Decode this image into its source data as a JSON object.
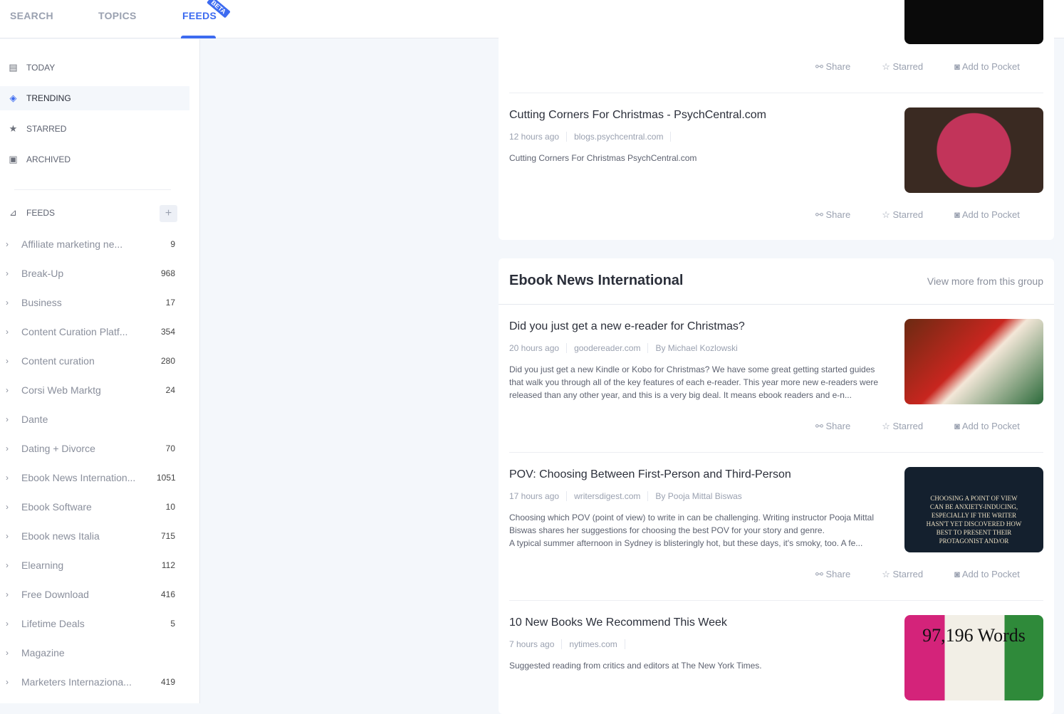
{
  "tabs": [
    {
      "label": "SEARCH"
    },
    {
      "label": "TOPICS"
    },
    {
      "label": "FEEDS",
      "badge": "BETA"
    }
  ],
  "nav": [
    {
      "label": "TODAY",
      "icon": "today-icon"
    },
    {
      "label": "TRENDING",
      "icon": "flame-icon"
    },
    {
      "label": "STARRED",
      "icon": "star-icon"
    },
    {
      "label": "ARCHIVED",
      "icon": "archive-icon"
    }
  ],
  "feeds_label": "FEEDS",
  "feeds": [
    {
      "name": "Affiliate marketing ne...",
      "count": "9"
    },
    {
      "name": "Break-Up",
      "count": "968"
    },
    {
      "name": "Business",
      "count": "17"
    },
    {
      "name": "Content Curation Platf...",
      "count": "354"
    },
    {
      "name": "Content curation",
      "count": "280"
    },
    {
      "name": "Corsi Web Marktg",
      "count": "24"
    },
    {
      "name": "Dante",
      "count": ""
    },
    {
      "name": "Dating + Divorce",
      "count": "70"
    },
    {
      "name": "Ebook News Internation...",
      "count": "1051"
    },
    {
      "name": "Ebook Software",
      "count": "10"
    },
    {
      "name": "Ebook news Italia",
      "count": "715"
    },
    {
      "name": "Elearning",
      "count": "112"
    },
    {
      "name": "Free Download",
      "count": "416"
    },
    {
      "name": "Lifetime Deals",
      "count": "5"
    },
    {
      "name": "Magazine",
      "count": ""
    },
    {
      "name": "Marketers Internaziona...",
      "count": "419"
    }
  ],
  "actions": {
    "share": "Share",
    "starred": "Starred",
    "pocket": "Add to Pocket"
  },
  "group": {
    "title": "Ebook News International",
    "more": "View more from this group"
  },
  "articles": [
    {
      "title": "Cutting Corners For Christmas - PsychCentral.com",
      "time": "12 hours ago",
      "source": "blogs.psychcentral.com",
      "author": "",
      "desc": "Cutting Corners For Christmas  PsychCentral.com"
    },
    {
      "title": "Did you just get a new e-reader for Christmas?",
      "time": "20 hours ago",
      "source": "goodereader.com",
      "author": "By Michael Kozlowski",
      "desc": "Did you just get a new Kindle or  Kobo  for Christmas? We have some great getting started guides that walk you through all of the key features of each e-reader. This year more new e-readers were released than any other year, and this is a very big deal. It means ebook readers and e-n..."
    },
    {
      "title": "POV: Choosing Between First-Person and Third-Person",
      "time": "17 hours ago",
      "source": "writersdigest.com",
      "author": "By Pooja Mittal Biswas",
      "desc": "Choosing which POV (point of view) to write in can be challenging. Writing instructor Pooja Mittal Biswas shares her suggestions for choosing the best POV for your story and genre.\nA typical summer afternoon in Sydney is blisteringly hot, but these days, it's smoky, too. A fe..."
    },
    {
      "title": "10 New Books We Recommend This Week",
      "time": "7 hours ago",
      "source": "nytimes.com",
      "author": "",
      "desc": "Suggested reading from critics and editors at The New York Times."
    }
  ],
  "thumb_text": {
    "pov": "CHOOSING A POINT OF VIEW CAN BE ANXIETY-INDUCING, ESPECIALLY IF THE WRITER HASN'T YET DISCOVERED HOW BEST TO PRESENT THEIR PROTAGONIST AND/OR",
    "books": "97,196 Words"
  }
}
